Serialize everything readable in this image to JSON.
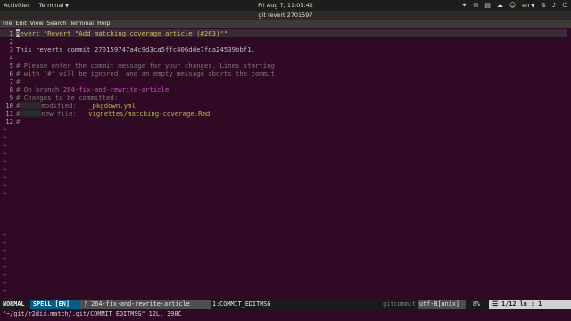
{
  "top_panel": {
    "activities": "Activities",
    "app_menu": "Terminal",
    "clock": "Fri Aug 7, 11:05:42",
    "language": "en"
  },
  "window": {
    "title": "git revert 2701597"
  },
  "menu": {
    "items": [
      "File",
      "Edit",
      "View",
      "Search",
      "Terminal",
      "Help"
    ]
  },
  "buffer": {
    "lines": [
      {
        "num": "1",
        "segments": [
          {
            "text": "R",
            "cls": "cursor"
          },
          {
            "text": "evert \"Revert \"Add matching coverage article (#263)\"\"",
            "cls": "c-summary"
          }
        ]
      },
      {
        "num": "2",
        "segments": []
      },
      {
        "num": "3",
        "segments": [
          {
            "text": "This reverts commit 270159747a4c9d3ca5ffc406dde7fda24539bbf1.",
            "cls": "c-normal"
          }
        ]
      },
      {
        "num": "4",
        "segments": []
      },
      {
        "num": "5",
        "segments": [
          {
            "text": "# Please enter the commit message for your changes. Lines starting",
            "cls": "c-comment"
          }
        ]
      },
      {
        "num": "6",
        "segments": [
          {
            "text": "# with '#' will be ignored, and an empty message aborts the commit.",
            "cls": "c-comment"
          }
        ]
      },
      {
        "num": "7",
        "segments": [
          {
            "text": "#",
            "cls": "c-comment"
          }
        ]
      },
      {
        "num": "8",
        "segments": [
          {
            "text": "# On branch ",
            "cls": "c-comment"
          },
          {
            "text": "264-fix-and-rewrite-article",
            "cls": "c-branch"
          }
        ]
      },
      {
        "num": "9",
        "segments": [
          {
            "text": "# Changes to be committed:",
            "cls": "c-comment"
          }
        ]
      },
      {
        "num": "10",
        "redact": true,
        "segments": [
          {
            "text": "modified:   ",
            "cls": "c-comment"
          },
          {
            "text": "_pkgdown.yml",
            "cls": "c-file"
          }
        ]
      },
      {
        "num": "11",
        "redact": true,
        "segments": [
          {
            "text": "new file:   ",
            "cls": "c-comment"
          },
          {
            "text": "vignettes/matching-coverage.Rmd",
            "cls": "c-file"
          }
        ]
      },
      {
        "num": "12",
        "segments": [
          {
            "text": "#",
            "cls": "c-comment"
          }
        ]
      }
    ],
    "tilde": "~"
  },
  "statusline": {
    "mode": "NORMAL",
    "spell": "SPELL [EN]",
    "branch": "ᚠ 264-fix-and-rewrite-article",
    "file": "1:COMMIT_EDITMSG",
    "filetype": "gitcommit",
    "encoding": "utf-8[unix]",
    "percent": "8%",
    "position": "☰   1/12 ln :   1"
  },
  "cmdline": "\"~/git/r2dii.match/.git/COMMIT_EDITMSG\" 12L, 398C",
  "colors": {
    "terminal_bg": "#300a24",
    "summary": "#c8bf55",
    "branch": "#c553c5",
    "file": "#b2b846",
    "comment": "#7a7a7a",
    "spell_bg": "#005f87"
  }
}
